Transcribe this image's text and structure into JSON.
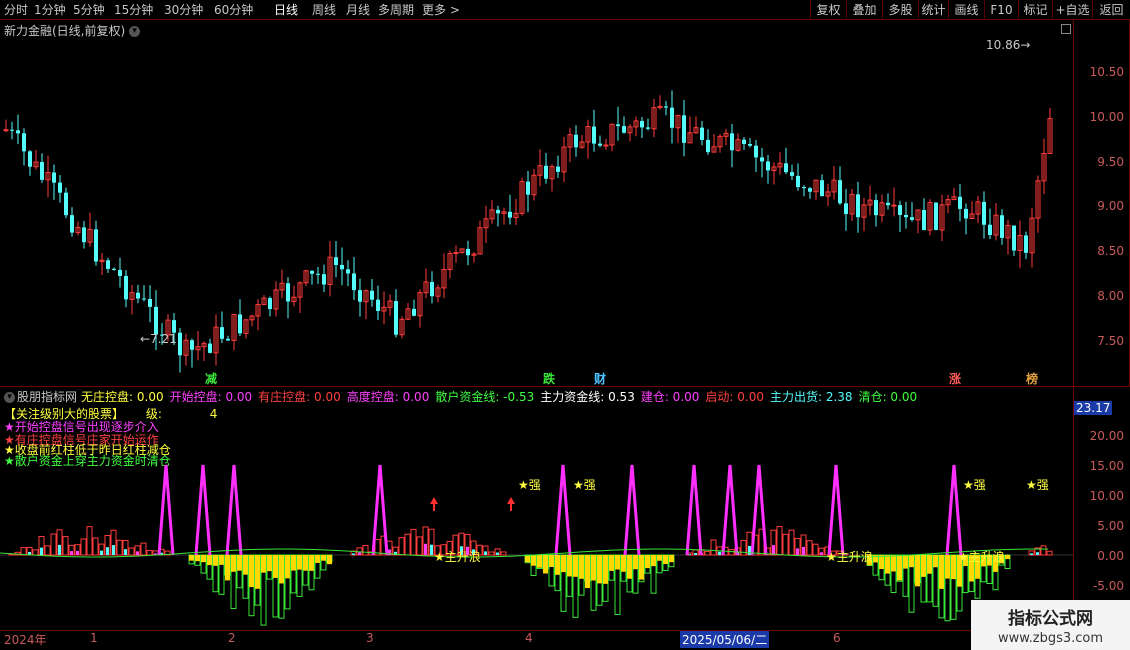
{
  "toolbar": {
    "periods": [
      "分时",
      "1分钟",
      "5分钟",
      "15分钟",
      "30分钟",
      "60分钟",
      "日线",
      "周线",
      "月线",
      "多周期",
      "更多 >"
    ],
    "active_period": "日线",
    "right_buttons": [
      "复权",
      "叠加",
      "多股",
      "统计",
      "画线",
      "F10",
      "标记",
      "+自选",
      "返回"
    ]
  },
  "main_chart": {
    "title": "新力金融(日线,前复权)",
    "high_label": "10.86",
    "low_label": "7.21",
    "y_ticks": [
      "10.50",
      "10.00",
      "9.50",
      "9.00",
      "8.50",
      "8.00",
      "7.50"
    ],
    "event_marks": [
      {
        "text": "减",
        "color": "#39e639"
      },
      {
        "text": "跌",
        "color": "#39e639"
      },
      {
        "text": "财",
        "color": "#4fc3ff"
      },
      {
        "text": "涨",
        "color": "#ff5a5a"
      },
      {
        "text": "榜",
        "color": "#e0a040"
      }
    ],
    "colors": {
      "up": "#ff3c3c",
      "down": "#54fcfc"
    }
  },
  "indicator": {
    "name": "股朋指标网",
    "values": [
      {
        "label": "无庄控盘:",
        "value": "0.00",
        "color": "#ffff40"
      },
      {
        "label": "开始控盘:",
        "value": "0.00",
        "color": "#ff40ff"
      },
      {
        "label": "有庄控盘:",
        "value": "0.00",
        "color": "#ff4040"
      },
      {
        "label": "高度控盘:",
        "value": "0.00",
        "color": "#ff40ff"
      },
      {
        "label": "散户资金线:",
        "value": "-0.53",
        "color": "#40ff40"
      },
      {
        "label": "主力资金线:",
        "value": "0.53",
        "color": "#ffffff"
      },
      {
        "label": "建仓:",
        "value": "0.00",
        "color": "#ff40ff"
      },
      {
        "label": "启动:",
        "value": "0.00",
        "color": "#ff4040"
      },
      {
        "label": "主力出货:",
        "value": "2.38",
        "color": "#54fcfc"
      },
      {
        "label": "清仓:",
        "value": "0.00",
        "color": "#40ff40"
      }
    ],
    "header_line": "【关注级别大的股票】",
    "level_label": "级:",
    "level_value": "4",
    "lines": [
      {
        "text": "★开始控盘信号出现逐步介入",
        "color": "#ff40ff"
      },
      {
        "text": "★有庄控盘信号庄家开始运作",
        "color": "#ff4040"
      },
      {
        "text": "★收盘前红柱低于昨日红柱减仓",
        "color": "#ffff40"
      },
      {
        "text": "★散户资金上穿主力资金时清仓",
        "color": "#40ff40"
      }
    ],
    "current_value": "23.17",
    "y_ticks": [
      "20.00",
      "15.00",
      "10.00",
      "5.00",
      "0.00",
      "-5.00"
    ],
    "strong_label": "★强",
    "rise_label": "★主升浪"
  },
  "x_axis": {
    "labels": [
      "2024年",
      "1",
      "2",
      "3",
      "4",
      "2025/05/06/二",
      "6"
    ]
  },
  "watermark": {
    "title": "指标公式网",
    "url": "www.zbgs3.com"
  }
}
